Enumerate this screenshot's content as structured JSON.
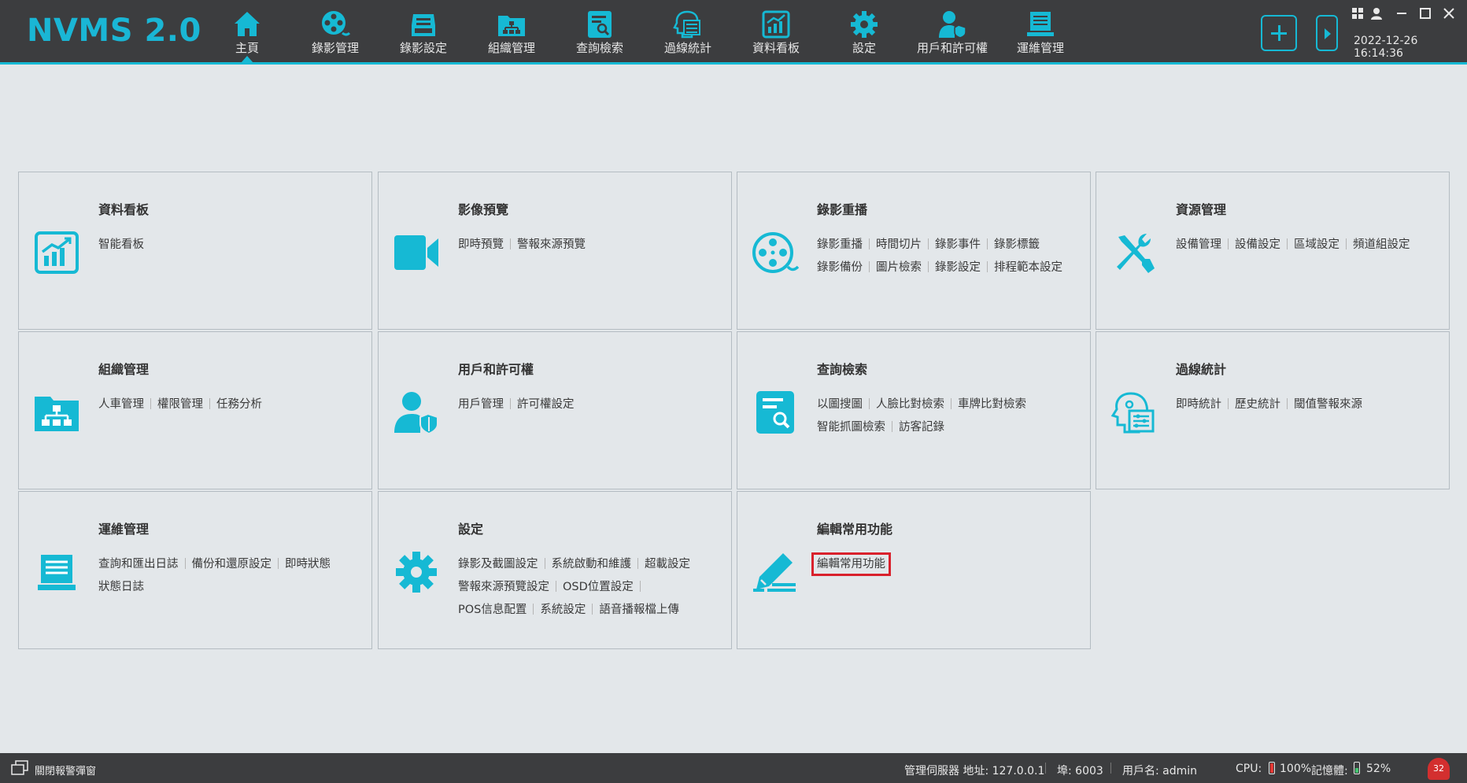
{
  "app": {
    "title": "NVMS 2.0"
  },
  "nav": [
    {
      "label": "主頁",
      "icon": "home-icon"
    },
    {
      "label": "錄影管理",
      "icon": "film-reel-icon"
    },
    {
      "label": "錄影設定",
      "icon": "recording-settings-icon"
    },
    {
      "label": "組織管理",
      "icon": "org-folder-icon"
    },
    {
      "label": "查詢檢索",
      "icon": "search-doc-icon"
    },
    {
      "label": "過線統計",
      "icon": "head-stats-icon"
    },
    {
      "label": "資料看板",
      "icon": "chart-board-icon"
    },
    {
      "label": "設定",
      "icon": "gear-icon"
    },
    {
      "label": "用戶和許可權",
      "icon": "user-shield-icon"
    },
    {
      "label": "運維管理",
      "icon": "monitor-icon"
    }
  ],
  "datetime": "2022-12-26 16:14:36",
  "tiles": [
    {
      "title": "資料看板",
      "icon": "chart-board-icon",
      "links": [
        "智能看板"
      ]
    },
    {
      "title": "影像預覽",
      "icon": "video-camera-icon",
      "links": [
        "即時預覽",
        "警報來源預覽"
      ]
    },
    {
      "title": "錄影重播",
      "icon": "film-reel-icon",
      "links": [
        "錄影重播",
        "時間切片",
        "錄影事件",
        "錄影標籤",
        "錄影備份",
        "圖片檢索",
        "錄影設定",
        "排程範本設定"
      ]
    },
    {
      "title": "資源管理",
      "icon": "tools-icon",
      "links": [
        "設備管理",
        "設備設定",
        "區域設定",
        "頻道組設定"
      ]
    },
    {
      "title": "組織管理",
      "icon": "org-folder-icon",
      "links": [
        "人車管理",
        "權限管理",
        "任務分析"
      ]
    },
    {
      "title": "用戶和許可權",
      "icon": "user-shield-icon",
      "links": [
        "用戶管理",
        "許可權設定"
      ]
    },
    {
      "title": "查詢檢索",
      "icon": "search-doc-icon",
      "links": [
        "以圖搜圖",
        "人臉比對檢索",
        "車牌比對檢索",
        "智能抓圖檢索",
        "訪客記錄"
      ]
    },
    {
      "title": "過線統計",
      "icon": "head-stats-icon",
      "links": [
        "即時統計",
        "歷史統計",
        "閾值警報來源"
      ]
    },
    {
      "title": "運維管理",
      "icon": "monitor-icon",
      "links": [
        "查詢和匯出日誌",
        "備份和還原設定",
        "即時狀態",
        "狀態日誌"
      ]
    },
    {
      "title": "設定",
      "icon": "gear-icon",
      "links": [
        "錄影及截圖設定",
        "系統啟動和維護",
        "超載設定",
        "警報來源預覽設定",
        "OSD位置設定",
        "POS信息配置",
        "系統設定",
        "語音播報檔上傳"
      ]
    },
    {
      "title": "編輯常用功能",
      "icon": "edit-pencil-icon",
      "links": [
        "編輯常用功能"
      ]
    }
  ],
  "status": {
    "alarm_popup": "關閉報警彈窗",
    "server": "管理伺服器 地址: 127.0.0.1",
    "port": "埠: 6003",
    "user": "用戶名: admin",
    "cpu_label": "CPU:",
    "cpu_value": "100%",
    "mem_label": "記憶體:",
    "mem_value": "52%",
    "alarm_count": "32"
  },
  "colors": {
    "accent": "#16b9d4",
    "topbar": "#3c3d3f",
    "background": "#e3e7ea",
    "highlight": "#d9212c"
  }
}
